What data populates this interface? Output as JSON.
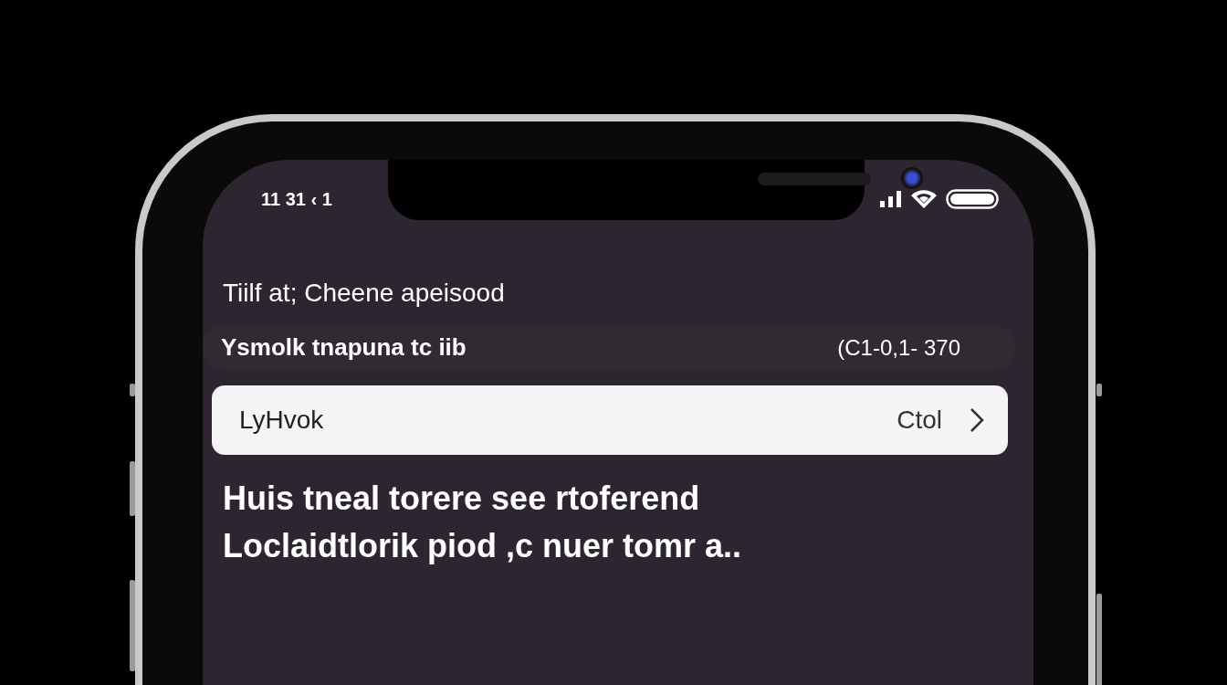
{
  "status_bar": {
    "time": "11 31 ‹ 1"
  },
  "header": {
    "title": "Tiilf at; Cheene apeisood"
  },
  "info_row": {
    "label": "Ysmolk tnapuna tc iib",
    "value": "(C1-0,1- 370"
  },
  "field": {
    "value": "LyHvok",
    "action": "Ctol"
  },
  "message": {
    "lines": [
      "Huis tneal torere see rtoferend",
      "Loclaidtlorik piod ,c nuer tomr a.."
    ]
  }
}
